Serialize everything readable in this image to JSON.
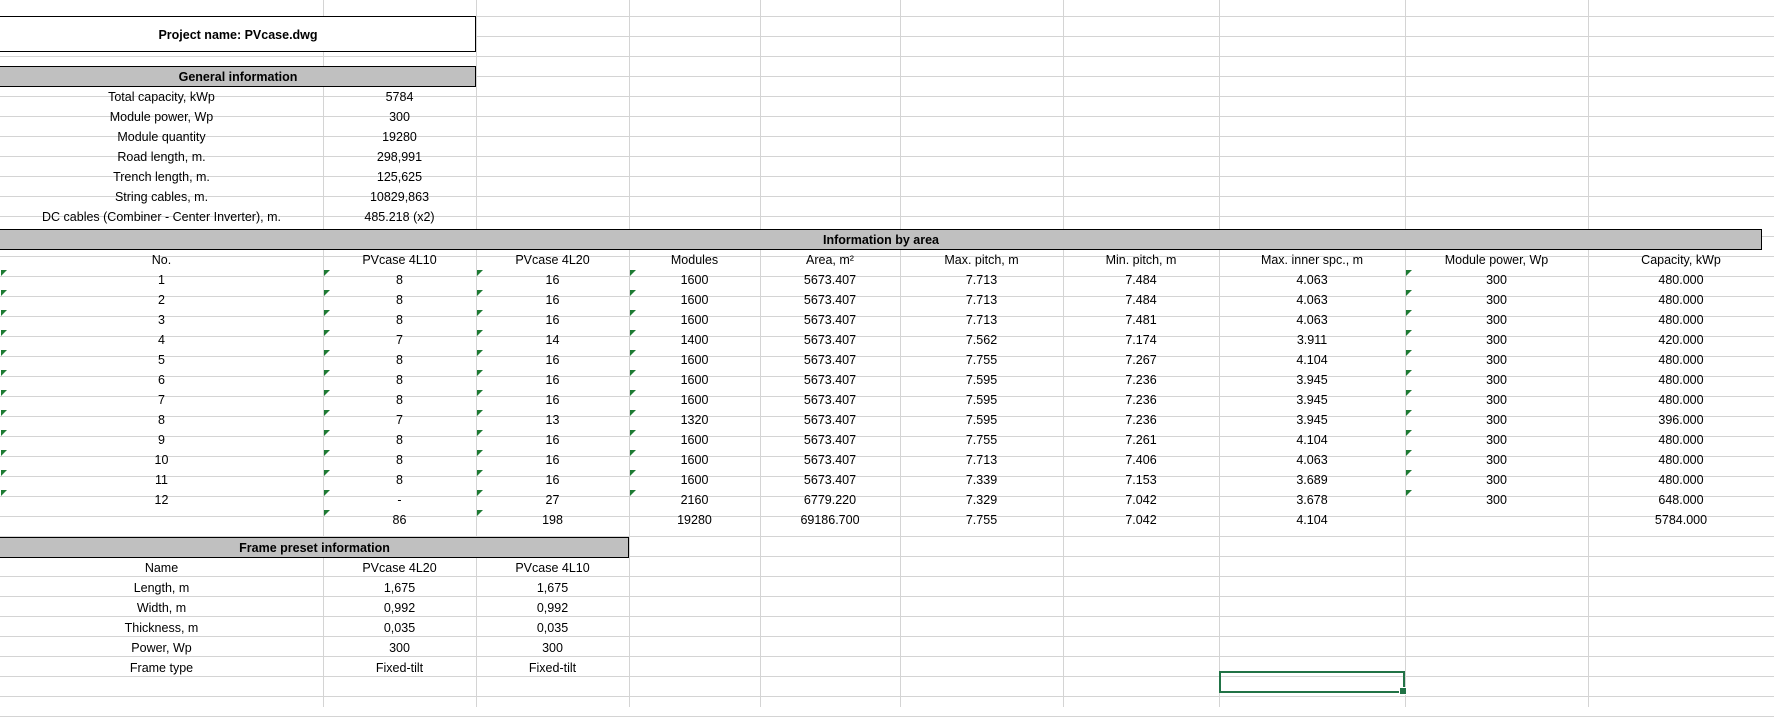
{
  "project": {
    "title": "Project name: PVcase.dwg"
  },
  "general": {
    "header": "General information",
    "rows": [
      {
        "label": "Total capacity, kWp",
        "value": "5784"
      },
      {
        "label": "Module power, Wp",
        "value": "300"
      },
      {
        "label": "Module quantity",
        "value": "19280"
      },
      {
        "label": "Road length, m.",
        "value": "298,991"
      },
      {
        "label": "Trench length, m.",
        "value": "125,625"
      },
      {
        "label": "String cables, m.",
        "value": "10829,863"
      },
      {
        "label": "DC cables (Combiner - Center Inverter), m.",
        "value": "485.218 (x2)"
      }
    ]
  },
  "area": {
    "header": "Information by area",
    "columns": [
      "No.",
      "PVcase 4L10",
      "PVcase 4L20",
      "Modules",
      "Area, m²",
      "Max. pitch, m",
      "Min. pitch, m",
      "Max. inner spc., m",
      "Module power, Wp",
      "Capacity, kWp"
    ],
    "rows": [
      [
        "1",
        "8",
        "16",
        "1600",
        "5673.407",
        "7.713",
        "7.484",
        "4.063",
        "300",
        "480.000"
      ],
      [
        "2",
        "8",
        "16",
        "1600",
        "5673.407",
        "7.713",
        "7.484",
        "4.063",
        "300",
        "480.000"
      ],
      [
        "3",
        "8",
        "16",
        "1600",
        "5673.407",
        "7.713",
        "7.481",
        "4.063",
        "300",
        "480.000"
      ],
      [
        "4",
        "7",
        "14",
        "1400",
        "5673.407",
        "7.562",
        "7.174",
        "3.911",
        "300",
        "420.000"
      ],
      [
        "5",
        "8",
        "16",
        "1600",
        "5673.407",
        "7.755",
        "7.267",
        "4.104",
        "300",
        "480.000"
      ],
      [
        "6",
        "8",
        "16",
        "1600",
        "5673.407",
        "7.595",
        "7.236",
        "3.945",
        "300",
        "480.000"
      ],
      [
        "7",
        "8",
        "16",
        "1600",
        "5673.407",
        "7.595",
        "7.236",
        "3.945",
        "300",
        "480.000"
      ],
      [
        "8",
        "7",
        "13",
        "1320",
        "5673.407",
        "7.595",
        "7.236",
        "3.945",
        "300",
        "396.000"
      ],
      [
        "9",
        "8",
        "16",
        "1600",
        "5673.407",
        "7.755",
        "7.261",
        "4.104",
        "300",
        "480.000"
      ],
      [
        "10",
        "8",
        "16",
        "1600",
        "5673.407",
        "7.713",
        "7.406",
        "4.063",
        "300",
        "480.000"
      ],
      [
        "11",
        "8",
        "16",
        "1600",
        "5673.407",
        "7.339",
        "7.153",
        "3.689",
        "300",
        "480.000"
      ],
      [
        "12",
        "-",
        "27",
        "2160",
        "6779.220",
        "7.329",
        "7.042",
        "3.678",
        "300",
        "648.000"
      ]
    ],
    "totals": [
      "",
      "86",
      "198",
      "19280",
      "69186.700",
      "7.755",
      "7.042",
      "4.104",
      "",
      "5784.000"
    ]
  },
  "frame": {
    "header": "Frame preset information",
    "columns": [
      "Name",
      "PVcase 4L20",
      "PVcase 4L10"
    ],
    "rows": [
      [
        "Length, m",
        "1,675",
        "1,675"
      ],
      [
        "Width, m",
        "0,992",
        "0,992"
      ],
      [
        "Thickness, m",
        "0,035",
        "0,035"
      ],
      [
        "Power, Wp",
        "300",
        "300"
      ],
      [
        "Frame type",
        "Fixed-tilt",
        "Fixed-tilt"
      ]
    ]
  },
  "colors": {
    "header_fill": "#c0c0c0",
    "gridline": "#d4d4d4",
    "selection": "#217346",
    "number_stored_as_text_flag": "#1e7b34"
  }
}
